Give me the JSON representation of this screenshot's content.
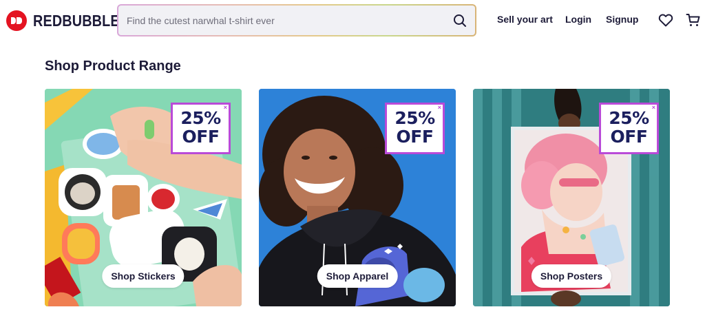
{
  "brand": {
    "name": "REDBUBBLE",
    "logo_color": "#e41321"
  },
  "search": {
    "placeholder": "Find the cutest narwhal t-shirt ever",
    "value": "",
    "icon": "search-icon"
  },
  "nav": {
    "sell_label": "Sell your art",
    "login_label": "Login",
    "signup_label": "Signup",
    "wishlist_icon": "heart-icon",
    "cart_icon": "cart-icon"
  },
  "section": {
    "title": "Shop Product Range"
  },
  "cards": [
    {
      "image": "stickers-photo",
      "promo_line1": "25%",
      "promo_line2": "OFF",
      "promo_close": "×",
      "button": "Shop Stickers"
    },
    {
      "image": "apparel-photo",
      "promo_line1": "25%",
      "promo_line2": "OFF",
      "promo_close": "×",
      "button": "Shop Apparel"
    },
    {
      "image": "posters-photo",
      "promo_line1": "25%",
      "promo_line2": "OFF",
      "promo_close": "×",
      "button": "Shop Posters"
    }
  ],
  "colors": {
    "text": "#1d1b38",
    "promo_border": "#b94ad8",
    "promo_text": "#1b1f5e",
    "search_bg": "#f1f1f5"
  }
}
